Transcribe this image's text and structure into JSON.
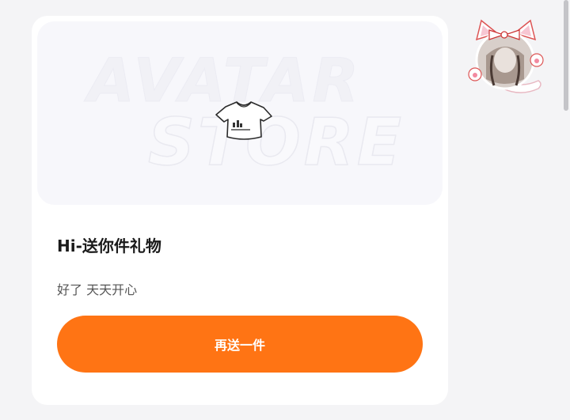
{
  "banner": {
    "watermark_line1": "AVATAR",
    "watermark_line2": "STORE",
    "item_icon": "crop-top-shirt-icon"
  },
  "gift": {
    "title": "Hi-送你件礼物",
    "message": "好了 天天开心"
  },
  "action": {
    "resend_label": "再送一件"
  },
  "profile": {
    "avatar_icon": "cat-ear-avatar-icon"
  },
  "colors": {
    "accent": "#ff7414",
    "page_bg": "#f4f4f6",
    "card_bg": "#ffffff",
    "banner_bg": "#f7f7fb"
  }
}
